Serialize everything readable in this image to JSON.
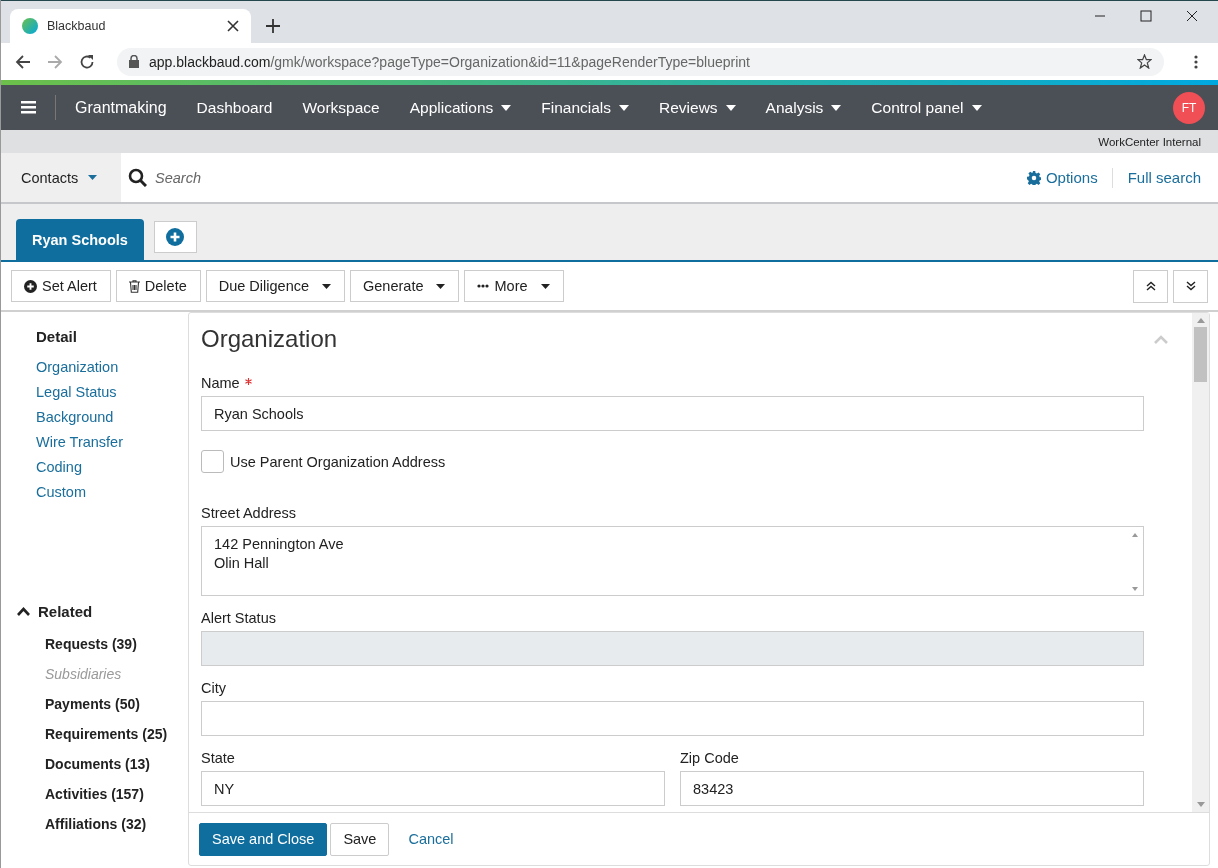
{
  "browser": {
    "tab_title": "Blackbaud",
    "url_host": "app.blackbaud.com",
    "url_path": "/gmk/workspace?pageType=Organization&id=11&pageRenderType=blueprint"
  },
  "nav": {
    "brand": "Grantmaking",
    "items": [
      {
        "label": "Dashboard",
        "dropdown": false
      },
      {
        "label": "Workspace",
        "dropdown": false
      },
      {
        "label": "Applications",
        "dropdown": true
      },
      {
        "label": "Financials",
        "dropdown": true
      },
      {
        "label": "Reviews",
        "dropdown": true
      },
      {
        "label": "Analysis",
        "dropdown": true
      },
      {
        "label": "Control panel",
        "dropdown": true
      }
    ],
    "avatar": "FT"
  },
  "environment": "WorkCenter Internal",
  "search": {
    "scope": "Contacts",
    "placeholder": "Search",
    "options": "Options",
    "full_search": "Full search"
  },
  "record_tabs": [
    {
      "label": "Ryan Schools",
      "selected": true
    }
  ],
  "toolbar": [
    {
      "label": "Set Alert",
      "kind": "add",
      "dropdown": false
    },
    {
      "label": "Delete",
      "kind": "delete",
      "dropdown": false
    },
    {
      "label": "Due Diligence",
      "kind": "plain",
      "dropdown": true
    },
    {
      "label": "Generate",
      "kind": "plain",
      "dropdown": true
    },
    {
      "label": "More",
      "kind": "overflow",
      "dropdown": true
    }
  ],
  "sidebar": {
    "detail_heading": "Detail",
    "detail_items": [
      "Organization",
      "Legal Status",
      "Background",
      "Wire Transfer",
      "Coding",
      "Custom"
    ],
    "related_heading": "Related",
    "related_expanded": true,
    "related_items": [
      {
        "label": "Requests (39)",
        "disabled": false
      },
      {
        "label": "Subsidiaries",
        "disabled": true
      },
      {
        "label": "Payments (50)",
        "disabled": false
      },
      {
        "label": "Requirements (25)",
        "disabled": false
      },
      {
        "label": "Documents (13)",
        "disabled": false
      },
      {
        "label": "Activities (157)",
        "disabled": false
      },
      {
        "label": "Affiliations (32)",
        "disabled": false
      }
    ]
  },
  "form": {
    "title": "Organization",
    "rows": [
      [
        {
          "kind": "text",
          "label": "Name",
          "required": true,
          "disabled": false,
          "value": "Ryan Schools"
        }
      ],
      [
        {
          "kind": "checkbox",
          "label": "Use Parent Organization Address",
          "checked": false
        }
      ],
      [
        {
          "kind": "textarea",
          "label": "Street Address",
          "lines": [
            "142 Pennington Ave",
            "Olin Hall"
          ]
        }
      ],
      [
        {
          "kind": "text",
          "label": "Alert Status",
          "required": false,
          "disabled": true
        }
      ],
      [
        {
          "kind": "text",
          "label": "City",
          "required": false,
          "disabled": false
        }
      ],
      [
        {
          "kind": "text",
          "label": "State",
          "required": false,
          "disabled": false,
          "value": "NY"
        },
        {
          "kind": "text",
          "label": "Zip Code",
          "required": false,
          "disabled": false,
          "value": "83423"
        }
      ]
    ]
  },
  "footer": [
    {
      "label": "Save and Close",
      "kind": "primary"
    },
    {
      "label": "Save",
      "kind": "secondary"
    },
    {
      "label": "Cancel",
      "kind": "link"
    }
  ]
}
